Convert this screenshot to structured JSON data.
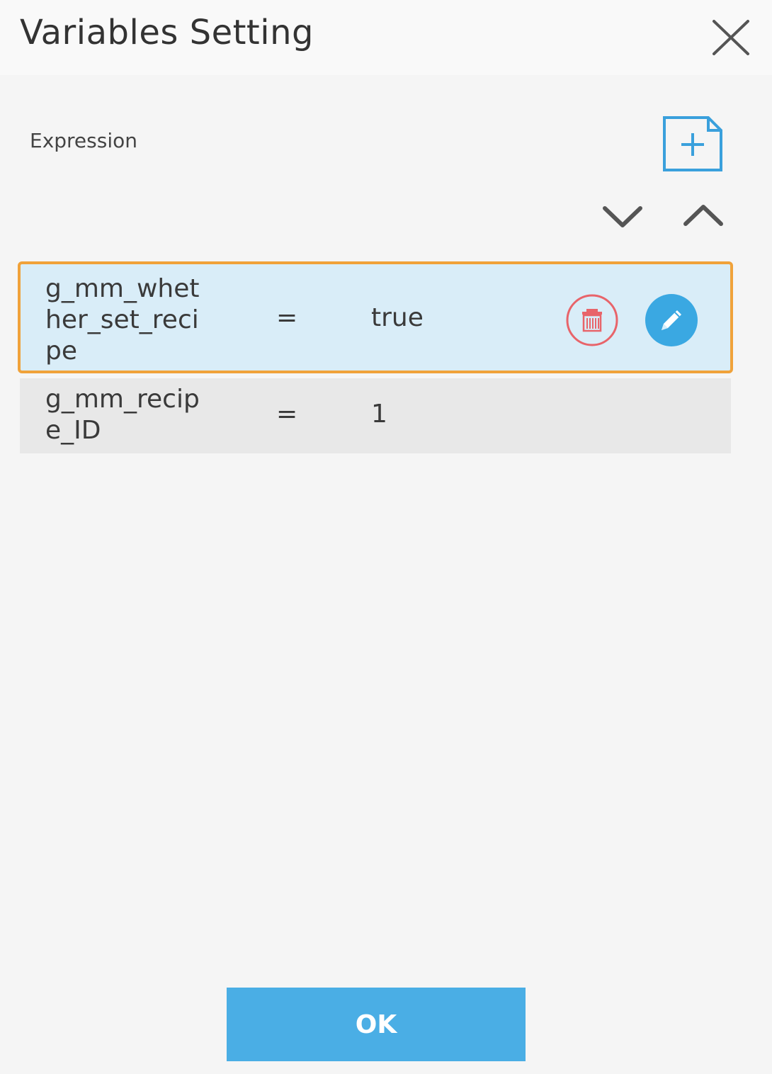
{
  "dialog": {
    "title": "Variables Setting",
    "close_icon": "close-icon"
  },
  "expression_section": {
    "label": "Expression",
    "add_icon": "add-file-icon",
    "move_down_icon": "chevron-down-icon",
    "move_up_icon": "chevron-up-icon"
  },
  "expressions": [
    {
      "variable": "g_mm_whether_set_recipe",
      "operator": "=",
      "value": "true",
      "selected": true,
      "delete_icon": "trash-icon",
      "edit_icon": "pencil-icon"
    },
    {
      "variable": "g_mm_recipe_ID",
      "operator": "=",
      "value": "1",
      "selected": false
    }
  ],
  "footer": {
    "ok_label": "OK"
  },
  "colors": {
    "accent": "#4aaee5",
    "selection_outline": "#f0a23a",
    "selected_row_bg": "#d9edf8",
    "delete_red": "#e8646a"
  }
}
